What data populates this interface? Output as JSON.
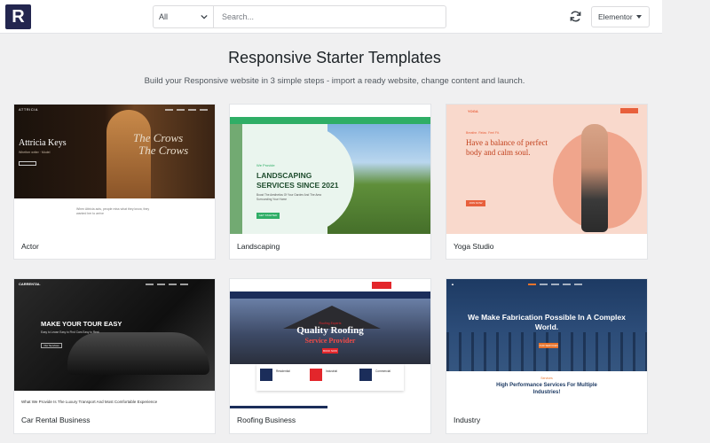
{
  "header": {
    "logo_letter": "R",
    "filter_value": "All",
    "search_placeholder": "Search...",
    "builder_value": "Elementor"
  },
  "main": {
    "title": "Responsive Starter Templates",
    "subtitle": "Build your Responsive website in 3 simple steps - import a ready website, change content and launch."
  },
  "templates": [
    {
      "name": "Actor",
      "preview": {
        "brand": "ATTRICIA",
        "headline": "Attricia Keys",
        "sub": "Whether writer · Model",
        "script": "The Crows",
        "script2": "The Crows",
        "quote": "When Attricia acts, people miss what they know, they wanted her to arrive"
      }
    },
    {
      "name": "Landscaping",
      "preview": {
        "tag": "We Provide",
        "headline": "LANDSCAPING",
        "headline2": "SERVICES SINCE 2021",
        "body": "Boost The Aesthetics Of Your Garden And The Area Surrounding Your Home",
        "cta": "GET STARTED"
      }
    },
    {
      "name": "Yoga Studio",
      "preview": {
        "brand": "YOGA",
        "eyebrow": "Breathe. Relax. Feel Fit.",
        "headline": "Have a balance of perfect body and calm soul.",
        "cta": "JOIN NOW"
      }
    },
    {
      "name": "Car Rental Business",
      "preview": {
        "brand": "CARRENTAL",
        "headline": "MAKE YOUR TOUR EASY",
        "body": "Easy to Lease Easy to Find Cars Easy to Rent",
        "cta": "Our Services",
        "footer": "What We Provide Is The Luxury Transport And Most Comfortable Experience"
      }
    },
    {
      "name": "Roofing Business",
      "preview": {
        "headline": "Quality Roofing",
        "headline2": "Service Provider",
        "eyebrow": "Roofing Experts",
        "cta": "BOOK NOW",
        "services": [
          "Residential",
          "Industrial",
          "Commercial"
        ]
      }
    },
    {
      "name": "Industry",
      "preview": {
        "headline": "We Make Fabrication Possible In A Complex World.",
        "cta": "OUR SERVICES",
        "eyebrow": "Services",
        "headline2": "High Performance Services For Multiple Industries!"
      }
    }
  ],
  "colors": {
    "brand": "#23264f",
    "page_bg": "#f0f0f1",
    "landscaping_accent": "#2fae66",
    "yoga_accent": "#e8603c",
    "roofing_accent": "#e3262b",
    "industry_accent": "#e8742c"
  },
  "icons": {
    "filter_chevron": "chevron-down-icon",
    "sync": "sync-icon",
    "builder_caret": "caret-down-icon"
  }
}
